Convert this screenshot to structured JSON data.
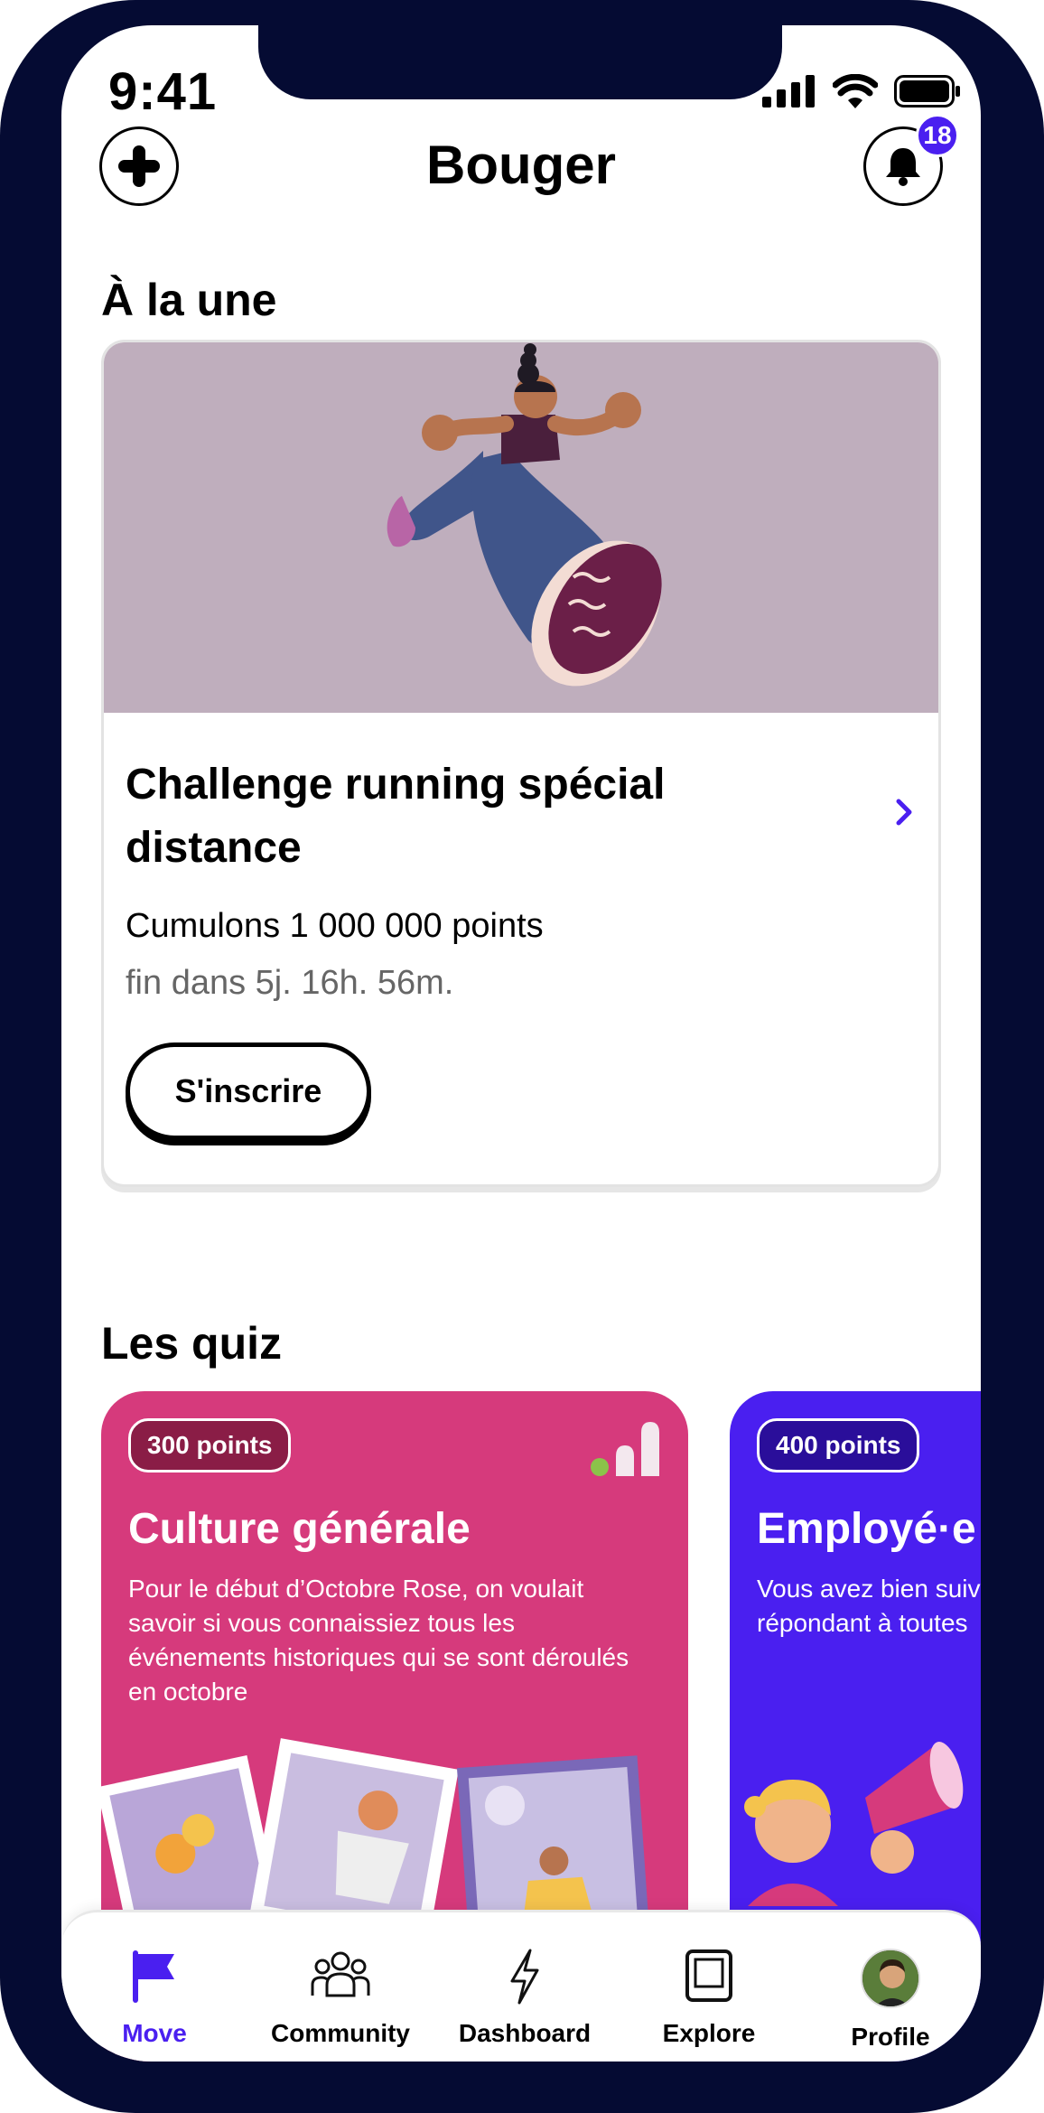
{
  "status_bar": {
    "time": "9:41"
  },
  "header": {
    "title": "Bouger",
    "notification_count": "18"
  },
  "featured": {
    "section_title": "À la une",
    "card": {
      "title": "Challenge running spécial distance",
      "subtitle": "Cumulons 1 000 000 points",
      "time_left": "fin dans 5j. 16h. 56m.",
      "cta_label": "S'inscrire"
    }
  },
  "quizzes": {
    "section_title": "Les quiz",
    "items": [
      {
        "points": "300 points",
        "title": "Culture générale",
        "description": "Pour le début d’Octobre Rose, on voulait savoir si vous connaissiez tous les événements historiques qui se sont déroulés en octobre",
        "color": "#d63a7c"
      },
      {
        "points": "400 points",
        "title": "Employé·e",
        "description": "Vous avez bien suiv Heroes en septemb répondant à toutes",
        "color": "#4a1ff0"
      }
    ]
  },
  "bottom_nav": {
    "items": [
      {
        "label": "Move",
        "icon": "flag-icon",
        "active": true
      },
      {
        "label": "Community",
        "icon": "community-icon",
        "active": false
      },
      {
        "label": "Dashboard",
        "icon": "lightning-icon",
        "active": false
      },
      {
        "label": "Explore",
        "icon": "tablet-icon",
        "active": false
      },
      {
        "label": "Profile",
        "icon": "avatar",
        "active": false
      }
    ]
  },
  "colors": {
    "accent": "#4a1ff0",
    "frame": "#050b33",
    "feature_bg": "#bfaebd",
    "quiz_pink": "#d63a7c",
    "quiz_purple": "#4a1ff0"
  }
}
